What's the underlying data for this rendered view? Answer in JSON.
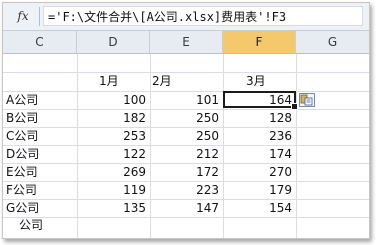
{
  "formula_bar": {
    "fx_label": "fx",
    "formula": "='F:\\文件合并\\[A公司.xlsx]费用表'!F3"
  },
  "columns": [
    "C",
    "D",
    "E",
    "F",
    "G"
  ],
  "active_column": "F",
  "header_row": {
    "d": "1月",
    "e": "2月",
    "f": "3月"
  },
  "rows": [
    {
      "c": "A公司",
      "d": "100",
      "e": "101",
      "f": "164"
    },
    {
      "c": "B公司",
      "d": "182",
      "e": "250",
      "f": "128"
    },
    {
      "c": "C公司",
      "d": "253",
      "e": "250",
      "f": "236"
    },
    {
      "c": "D公司",
      "d": "122",
      "e": "212",
      "f": "174"
    },
    {
      "c": "E公司",
      "d": "269",
      "e": "172",
      "f": "270"
    },
    {
      "c": "F公司",
      "d": "119",
      "e": "223",
      "f": "179"
    },
    {
      "c": "G公司",
      "d": "135",
      "e": "147",
      "f": "154"
    }
  ],
  "partial_row": {
    "c": "公司"
  },
  "paste_options_icon": "paste-options-icon"
}
